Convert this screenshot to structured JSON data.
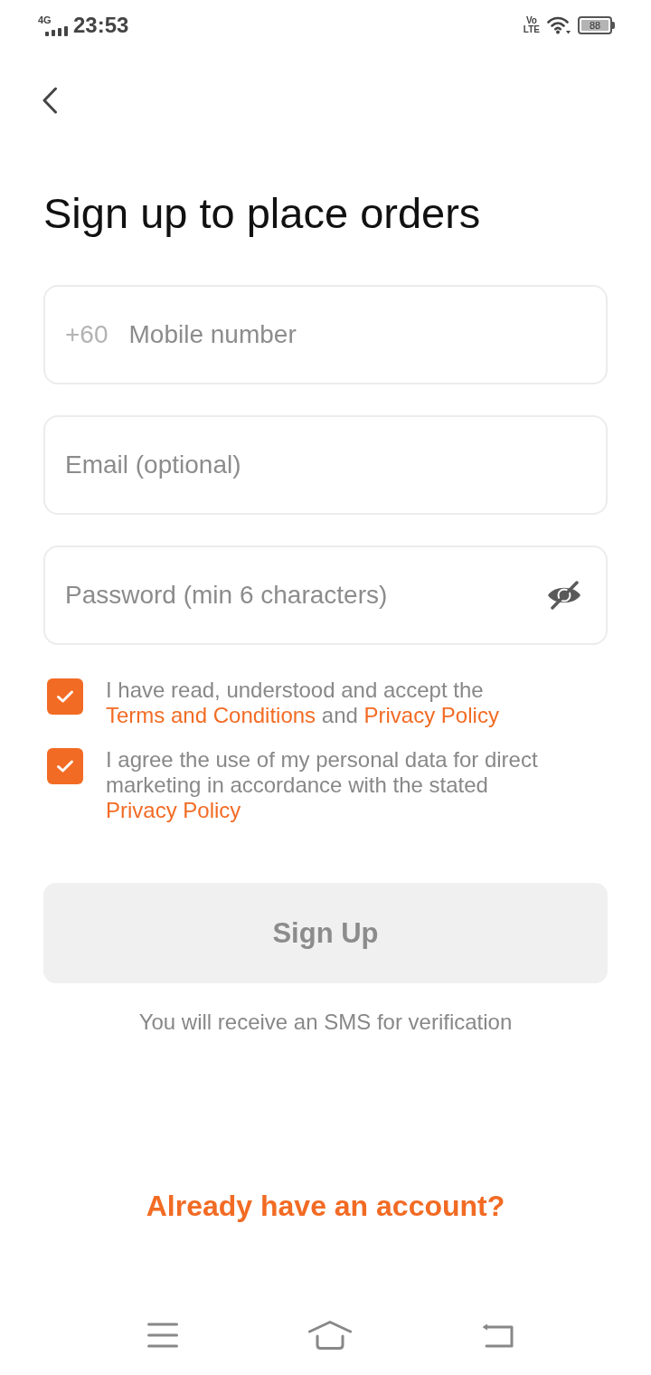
{
  "status_bar": {
    "network": "4G",
    "time": "23:53",
    "volte": [
      "Vo",
      "LTE"
    ],
    "battery": "88"
  },
  "title": "Sign up to place orders",
  "fields": [
    {
      "kind": "phone",
      "prefix": "+60",
      "placeholder": "Mobile number"
    },
    {
      "kind": "email",
      "placeholder": "Email (optional)"
    },
    {
      "kind": "password",
      "placeholder": "Password (min 6 characters)"
    }
  ],
  "consents": [
    {
      "checked": true,
      "parts": [
        {
          "kind": "text",
          "text": "I have read, understood and accept the "
        },
        {
          "kind": "link",
          "text": "Terms and Conditions"
        },
        {
          "kind": "text",
          "text": " and "
        },
        {
          "kind": "link",
          "text": "Privacy Policy"
        }
      ]
    },
    {
      "checked": true,
      "parts": [
        {
          "kind": "text",
          "text": "I agree the use of my personal data for direct marketing in accordance with the stated "
        },
        {
          "kind": "link",
          "text": "Privacy Policy"
        }
      ]
    }
  ],
  "sign_up": {
    "label": "Sign Up",
    "disabled": true
  },
  "note": "You will receive an SMS for verification",
  "login_link": "Already have an account?"
}
